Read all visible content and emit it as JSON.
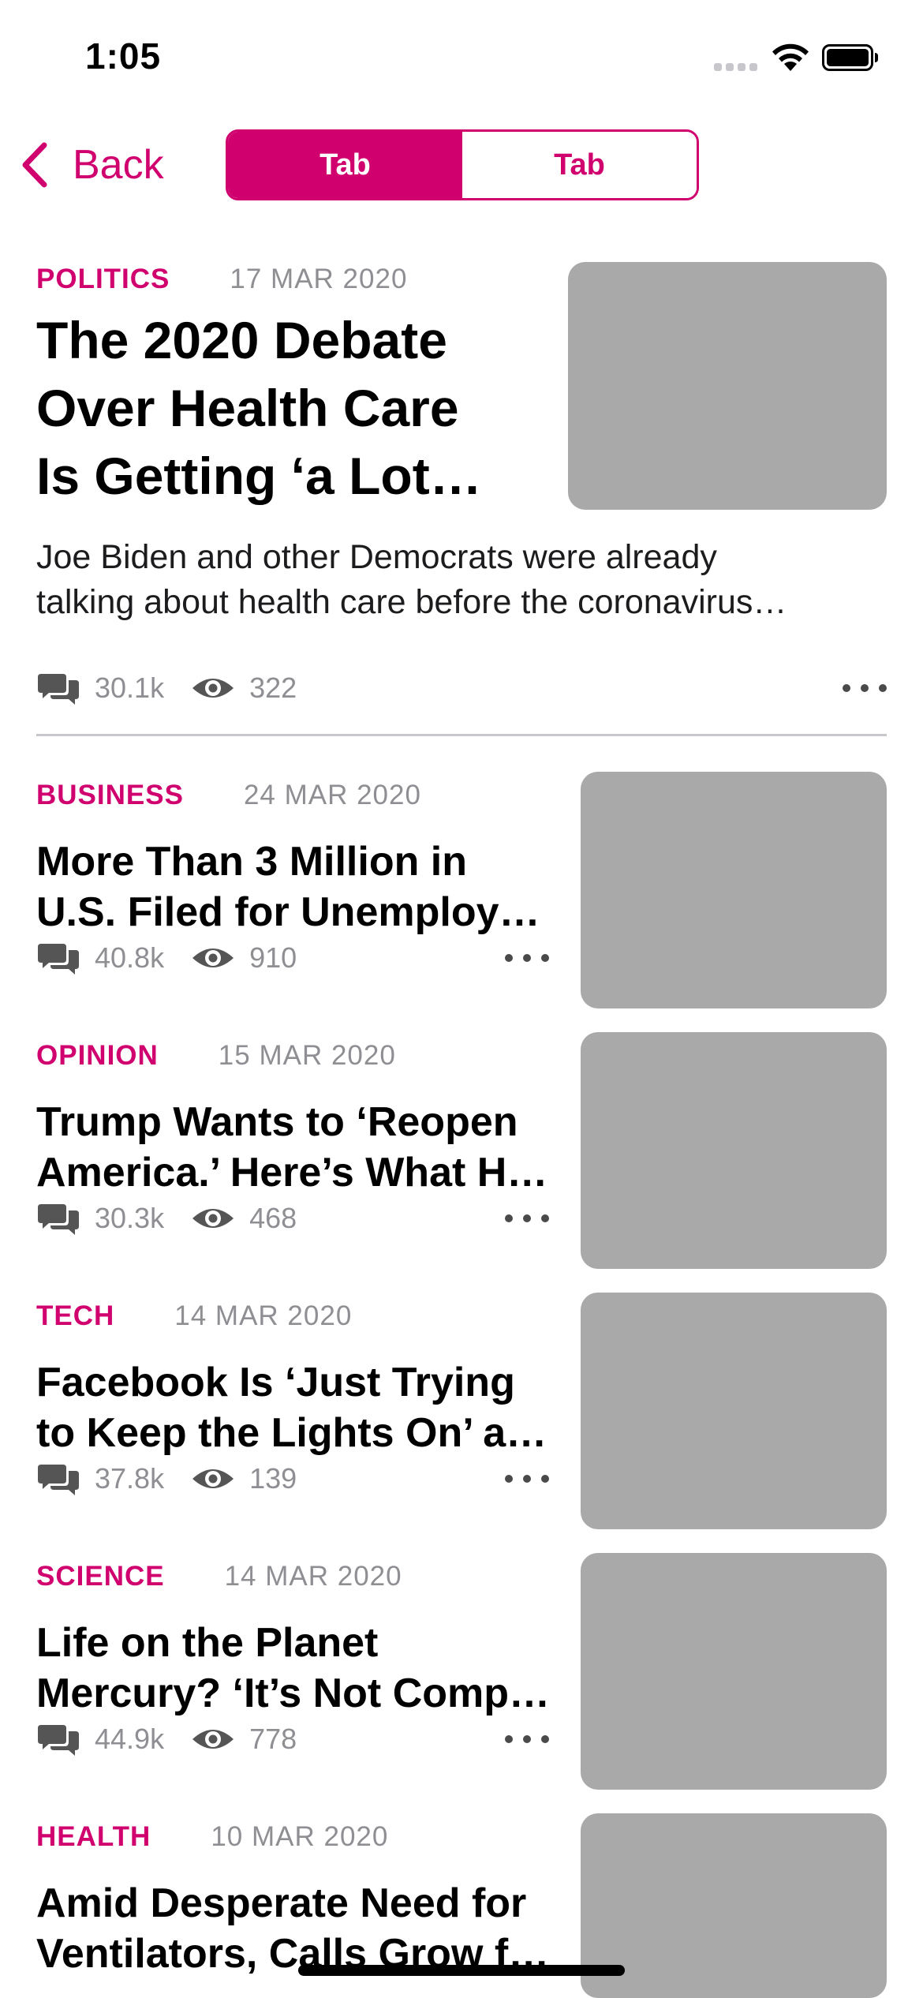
{
  "status_bar": {
    "time": "1:05"
  },
  "nav": {
    "back_label": "Back",
    "tabs": [
      {
        "label": "Tab",
        "active": true
      },
      {
        "label": "Tab",
        "active": false
      }
    ]
  },
  "colors": {
    "accent": "#d0006f",
    "placeholder": "#a9a9a9",
    "meta": "#8e8e93"
  },
  "featured": {
    "category": "POLITICS",
    "date": "17 MAR 2020",
    "title_lines": [
      "The 2020 Debate",
      "Over Health Care",
      "Is Getting ‘a Lot…"
    ],
    "summary_lines": [
      "Joe Biden and other Democrats were already",
      "talking about health care before the coronavirus…"
    ],
    "comments": "30.1k",
    "views": "322"
  },
  "articles": [
    {
      "category": "BUSINESS",
      "date": "24 MAR 2020",
      "title_lines": [
        "More Than 3 Million in",
        "U.S. Filed for Unemploy…"
      ],
      "comments": "40.8k",
      "views": "910"
    },
    {
      "category": "OPINION",
      "date": "15 MAR 2020",
      "title_lines": [
        "Trump Wants to ‘Reopen",
        "America.’ Here’s What H…"
      ],
      "comments": "30.3k",
      "views": "468"
    },
    {
      "category": "TECH",
      "date": "14 MAR 2020",
      "title_lines": [
        "Facebook Is ‘Just Trying",
        "to Keep the Lights On’ a…"
      ],
      "comments": "37.8k",
      "views": "139"
    },
    {
      "category": "SCIENCE",
      "date": "14 MAR 2020",
      "title_lines": [
        "Life on the Planet",
        "Mercury? ‘It’s Not Comp…"
      ],
      "comments": "44.9k",
      "views": "778"
    },
    {
      "category": "HEALTH",
      "date": "10 MAR 2020",
      "title_lines": [
        "Amid Desperate Need for",
        "Ventilators, Calls Grow f…"
      ],
      "comments": "",
      "views": ""
    }
  ],
  "icons": {
    "back": "chevron-left-icon",
    "comments": "speech-bubbles-icon",
    "views": "eye-icon",
    "more": "ellipsis-icon"
  }
}
